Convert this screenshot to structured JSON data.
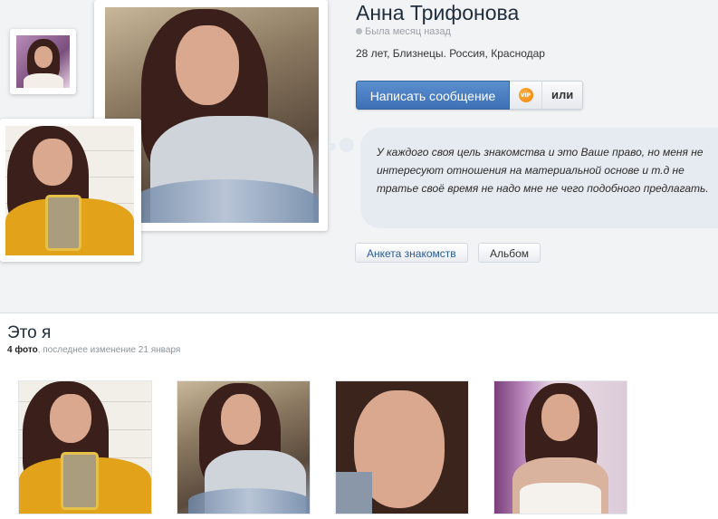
{
  "profile": {
    "name": "Анна Трифонова",
    "status": "Была месяц назад",
    "info": "28 лет, Близнецы. Россия, Краснодар",
    "about": "У каждого своя цель знакомства и это Ваше право, но меня не интересуют отношения на материальной основе и т.д не тратье своё время не надо мне не чего подобного предлагать."
  },
  "actions": {
    "write_message": "Написать сообщение",
    "vip_icon": "vip-icon",
    "vip_text": "VIP",
    "or_label": "или"
  },
  "tabs": {
    "anketa": "Анкета знакомств",
    "album": "Альбом"
  },
  "album": {
    "title": "Это я",
    "count": "4 фото",
    "updated": ", последнее изменение 21 января"
  },
  "colors": {
    "accent": "#3e70b5",
    "page_bg": "#f2f3f5",
    "bubble_bg": "#e6ebf1"
  }
}
